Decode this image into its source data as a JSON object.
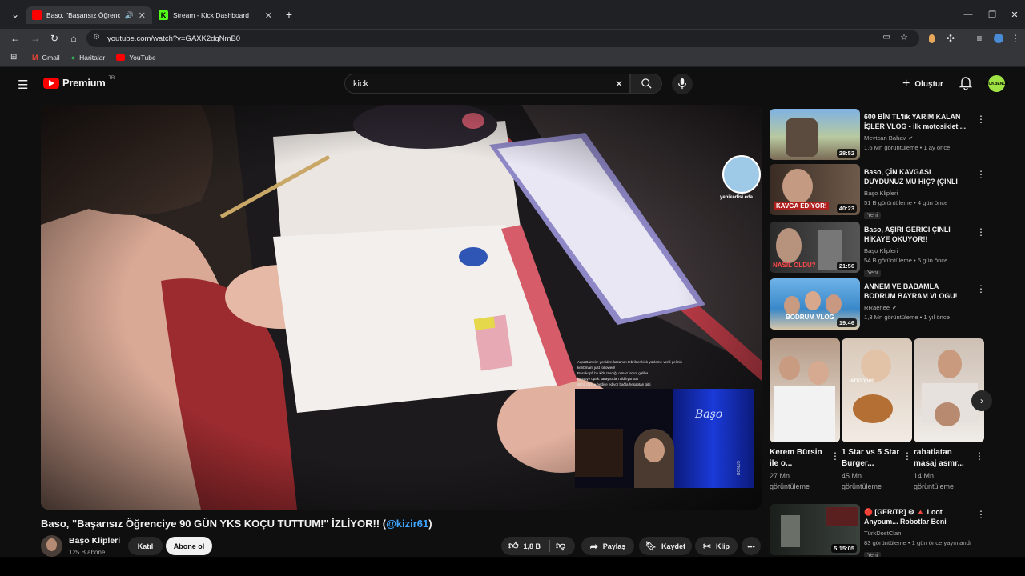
{
  "browser": {
    "tabs": [
      {
        "title": "Baso, \"Başarısız Öğrenciye 90 GÜN YKS KOÇU TUTTUM!\" İZLİYOR!!",
        "active": true
      },
      {
        "title": "Stream - Kick Dashboard",
        "active": false
      }
    ],
    "url": "youtube.com/watch?v=GAXK2dqNmB0",
    "bookmarks": [
      "Gmail",
      "Haritalar",
      "YouTube"
    ]
  },
  "youtube": {
    "logo_text": "Premium",
    "region": "TR",
    "search_value": "kick",
    "create_label": "Oluştur",
    "avatar_text": "KICKBENCH"
  },
  "player": {
    "overlay_name": "yenikedisi eda",
    "webcam_logo": "Başo",
    "webcam_caption": "BONUS",
    "chat_lines": [
      "AqsaDanwin: yeniden kacanım tebrikler kick yükleme verili gelmiş",
      "kenbmanf just followed!",
      "Basokopf: bu ki'ln tasdığı olmaz lazım galiba",
      "iAnnuyy opak: tarayıcıdan aldılıyorsun",
      "sBhl: düzce hediye ediyor bağla hesaptan gitti"
    ]
  },
  "video": {
    "title_main": "Baso, \"Başarısız Öğrenciye 90 GÜN YKS KOÇU TUTTUM!\" İZLİYOR!! (",
    "title_link": "@kizir61",
    "title_end": ")",
    "channel_name": "Başo Klipleri",
    "subscribers": "125 B abone",
    "join_label": "Katıl",
    "subscribe_label": "Abone ol",
    "like_count": "1,8 B",
    "share_label": "Paylaş",
    "save_label": "Kaydet",
    "clip_label": "Klip"
  },
  "sidebar": {
    "videos": [
      {
        "title": "600 BİN TL'lik YARIM KALAN İŞLER VLOG - ilk motosiklet ...",
        "channel": "Mevtcan Bahav",
        "verified": true,
        "stats": "1,6 Mn görüntüleme • 1 ay önce",
        "duration": "28:52",
        "badge": ""
      },
      {
        "title": "Baso, ÇİN KAVGASI DUYDUNUZ MU HİÇ? (ÇİNLİ HİKAYE) ...",
        "channel": "Başo Klipleri",
        "verified": false,
        "stats": "51 B görüntüleme • 4 gün önce",
        "duration": "40:23",
        "badge": "Yeni",
        "thumb_text": "KAVGA EDİYOR!"
      },
      {
        "title": "Baso, AŞIRI GERİCİ ÇİNLİ HİKAYE OKUYOR!!",
        "channel": "Başo Klipleri",
        "verified": false,
        "stats": "54 B görüntüleme • 5 gün önce",
        "duration": "21:56",
        "badge": "Yeni",
        "thumb_text": "NASIL OLDU?"
      },
      {
        "title": "ANNEM VE BABAMLA BODRUM BAYRAM VLOGU!",
        "channel": "RRaenee",
        "verified": true,
        "stats": "1,3 Mn görüntüleme • 1 yıl önce",
        "duration": "19:46",
        "badge": "",
        "thumb_text": "BODRUM VLOG"
      }
    ],
    "shorts": [
      {
        "title": "Kerem Bürsin ile o...",
        "views": "27 Mn görüntüleme"
      },
      {
        "title": "1 Star vs 5 Star Burger...",
        "views": "45 Mn görüntüleme",
        "thumb_text": "whopper"
      },
      {
        "title": "rahatlatan masaj asmr...",
        "views": "14 Mn görüntüleme"
      }
    ],
    "live": {
      "title": "🔴 [GER/TR] ⚙ 🔺 Loot Anyoum... Robotlar Beni Anyo...",
      "channel": "TürkDostClan",
      "stats": "83 görüntüleme • 1 gün önce yayınlandı",
      "duration": "5:15:05",
      "badge": "Yeni"
    }
  },
  "colors": {
    "yt_red": "#ff0000",
    "link_blue": "#3ea6ff",
    "kick_green": "#53fc18",
    "background": "#0f0f0f"
  }
}
